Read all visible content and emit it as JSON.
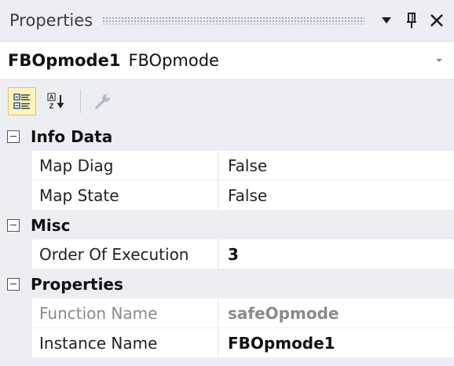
{
  "panel": {
    "title": "Properties",
    "buttons": {
      "dropdown": "window-position-menu",
      "pin": "pin",
      "close": "close"
    }
  },
  "selector": {
    "object_name": "FBOpmode1",
    "object_type": "FBOpmode"
  },
  "toolbar": {
    "items": [
      {
        "icon": "categorized-icon",
        "active": true
      },
      {
        "icon": "alphabetical-icon",
        "active": false
      },
      {
        "icon": "property-pages-icon",
        "active": false,
        "disabled": true
      }
    ]
  },
  "grid": {
    "categories": [
      {
        "label": "Info Data",
        "rows": [
          {
            "name": "Map Diag",
            "value": "False"
          },
          {
            "name": "Map State",
            "value": "False"
          }
        ]
      },
      {
        "label": "Misc",
        "rows": [
          {
            "name": "Order Of Execution",
            "value": "3"
          }
        ]
      },
      {
        "label": "Properties",
        "rows": [
          {
            "name": "Function Name",
            "value": "safeOpmode"
          },
          {
            "name": "Instance Name",
            "value": "FBOpmode1"
          }
        ]
      }
    ]
  },
  "colors": {
    "panel_bg": "#eceef3",
    "active_tool_bg": "#fdf4bf",
    "active_tool_border": "#e5c365"
  }
}
